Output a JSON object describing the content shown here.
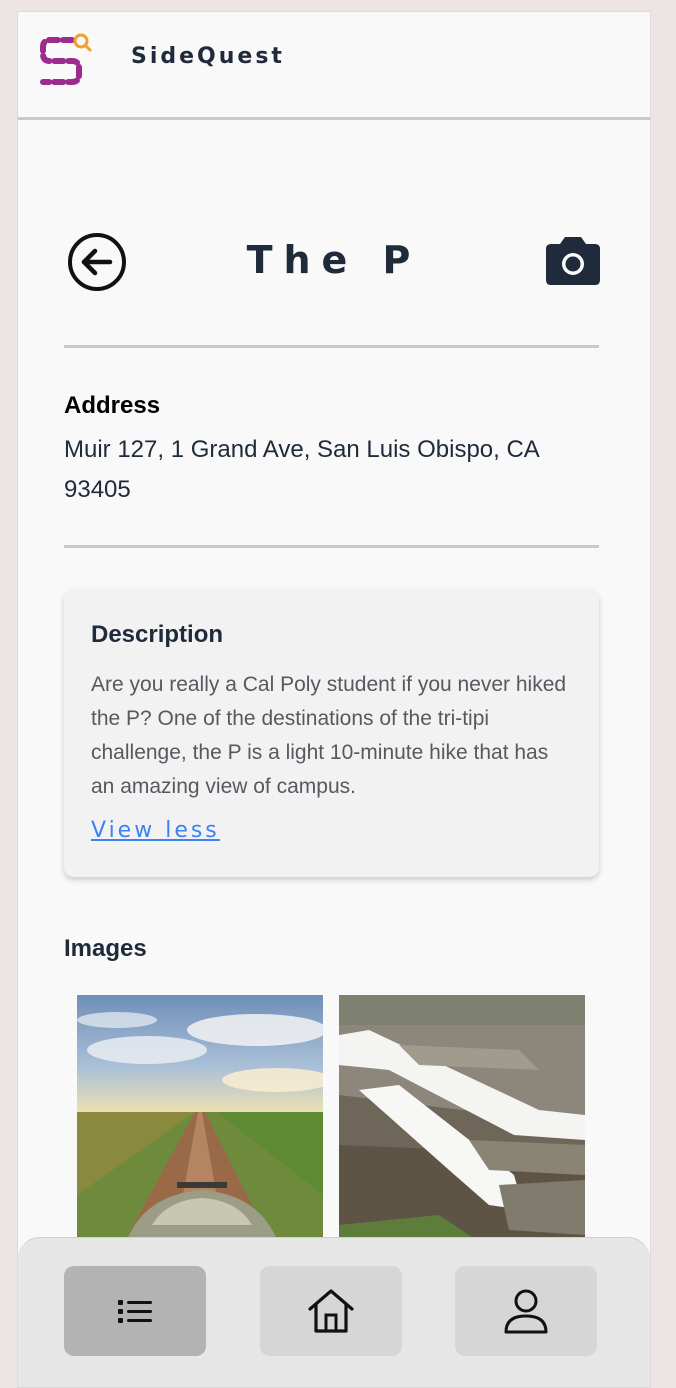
{
  "app": {
    "name": "SideQuest",
    "logo_icon": "sidequest-logo",
    "brand_colors": {
      "logo_purple": "#9b2c8e",
      "logo_orange": "#f0a030"
    }
  },
  "header": {
    "title": "The P",
    "back_icon": "arrow-left-circle-icon",
    "camera_icon": "camera-icon"
  },
  "address": {
    "label": "Address",
    "value": "Muir 127, 1 Grand Ave, San Luis Obispo, CA 93405"
  },
  "description": {
    "title": "Description",
    "text": "Are you really a Cal Poly student if you never hiked the P? One of the destinations of the tri-tipi challenge, the P is a light 10-minute hike that has an amazing view of campus.",
    "toggle_label": "View less"
  },
  "images": {
    "label": "Images",
    "items": [
      "dirt-road-landscape-photo",
      "stone-p-hillside-photo"
    ]
  },
  "nav": {
    "items": [
      {
        "icon": "list-icon",
        "active": true
      },
      {
        "icon": "home-icon",
        "active": false
      },
      {
        "icon": "user-icon",
        "active": false
      }
    ]
  },
  "colors": {
    "text_dark": "#1f2a3a",
    "link": "#3b82f6",
    "divider": "#c9c9d4",
    "nav_active": "#b3b3b3"
  }
}
